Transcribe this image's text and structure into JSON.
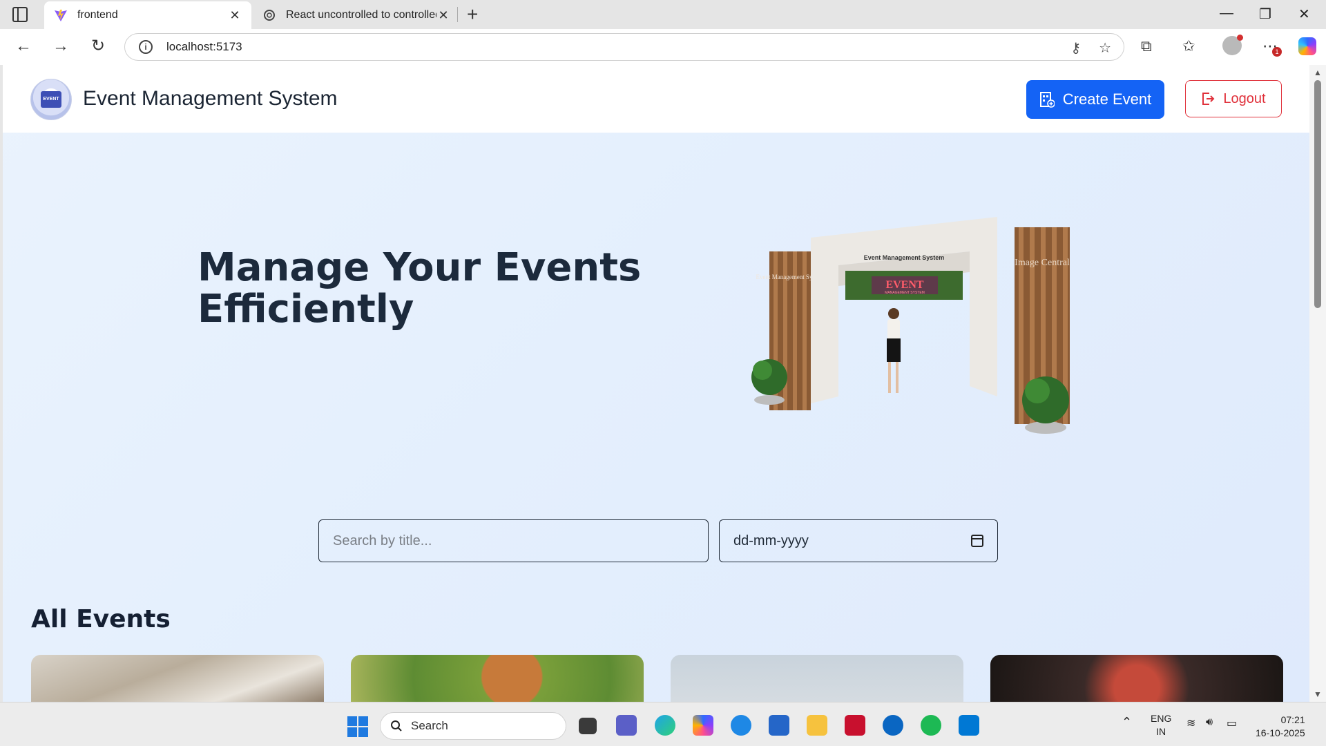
{
  "browser": {
    "tabs": [
      {
        "title": "frontend",
        "active": true
      },
      {
        "title": "React uncontrolled to controlled",
        "active": false
      }
    ],
    "url": "localhost:5173",
    "notification_count": "1"
  },
  "header": {
    "brand": "Event Management System",
    "create_label": "Create Event",
    "logout_label": "Logout"
  },
  "hero": {
    "title": "Manage Your Events Efficiently",
    "image": {
      "sign_top": "Event Management System",
      "banner": "EVENT",
      "banner_sub": "MANAGEMENT SYSTEM",
      "side_left": "Event Management System",
      "side_right": "Image Central"
    }
  },
  "filters": {
    "search_placeholder": "Search by title...",
    "date_placeholder": "dd-mm-yyyy"
  },
  "events": {
    "section_title": "All Events"
  },
  "taskbar": {
    "search_label": "Search",
    "lang": "ENG",
    "region": "IN",
    "time": "07:21",
    "date": "16-10-2025"
  }
}
